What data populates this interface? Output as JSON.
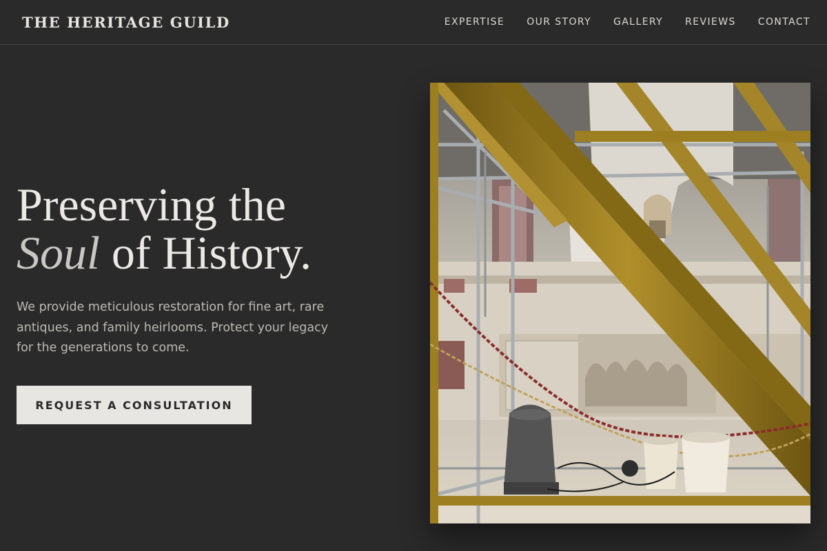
{
  "header": {
    "brand": "THE HERITAGE GUILD",
    "nav": [
      "EXPERTISE",
      "OUR STORY",
      "GALLERY",
      "REVIEWS",
      "CONTACT"
    ]
  },
  "hero": {
    "headline_line1": "Preserving the",
    "headline_em": "Soul",
    "headline_rest": " of History.",
    "lede": "We provide meticulous restoration for fine art, rare antiques, and family heirlooms. Protect your legacy for the generations to come.",
    "cta_label": "REQUEST A CONSULTATION"
  },
  "colors": {
    "background": "#2a2a2a",
    "text": "#e8e6e3",
    "cta_bg": "#e8e6e3",
    "scaffold": "#9c7e1e"
  }
}
